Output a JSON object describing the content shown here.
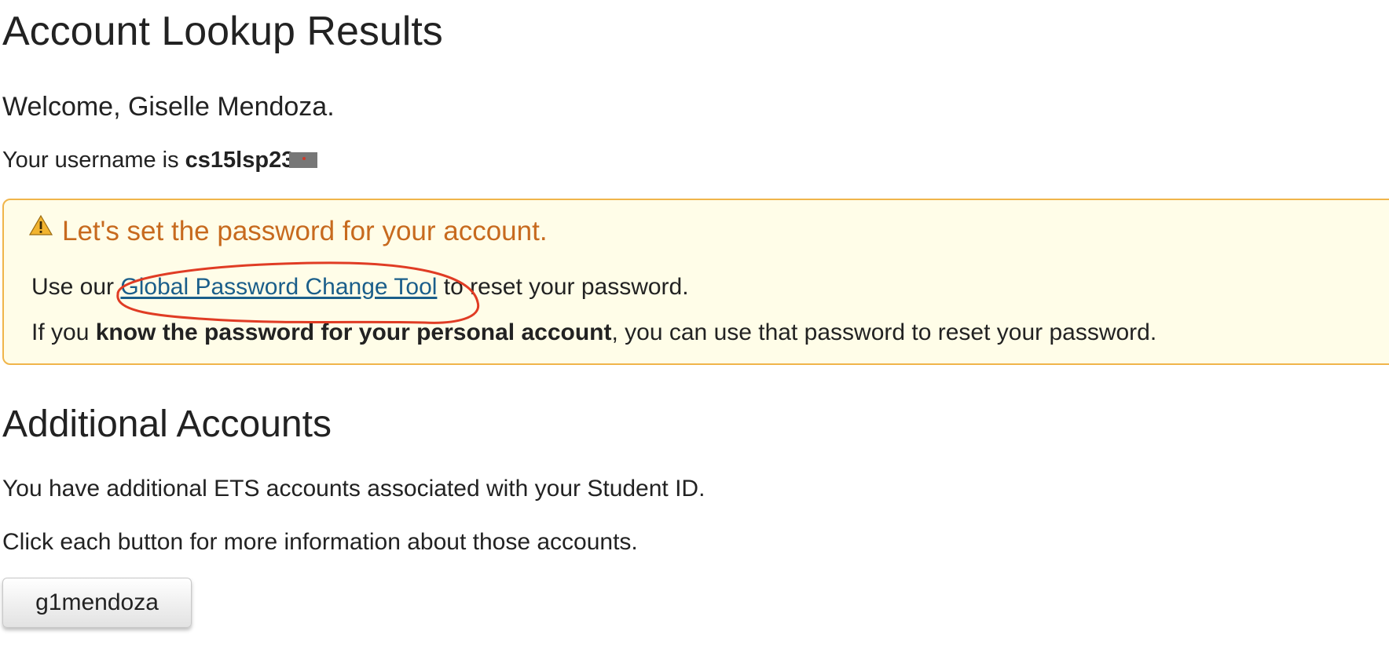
{
  "header": {
    "title": "Account Lookup Results"
  },
  "account": {
    "welcome": "Welcome, Giselle Mendoza.",
    "username_prefix": "Your username is ",
    "username_visible": "cs15lsp23"
  },
  "alert": {
    "icon": "warning-icon",
    "heading": "Let's set the password for your account.",
    "line1_before": "Use our ",
    "link_text": "Global Password Change Tool",
    "line1_after": " to reset your password.",
    "line2_before": "If you ",
    "line2_bold": "know the password for your personal account",
    "line2_after": ", you can use that password to reset your password."
  },
  "additional_accounts": {
    "title": "Additional Accounts",
    "description1": "You have additional ETS accounts associated with your Student ID.",
    "description2": "Click each button for more information about those accounts.",
    "buttons": [
      {
        "label": "g1mendoza"
      }
    ]
  },
  "colors": {
    "alert_background": "#fffde8",
    "alert_border": "#f0b54a",
    "alert_heading": "#c76a1e",
    "link": "#1a5e8a",
    "annotation": "#e03c24"
  }
}
